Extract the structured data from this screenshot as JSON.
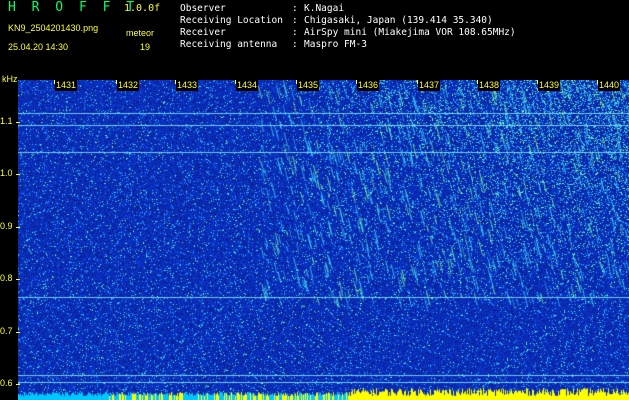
{
  "header": {
    "brand": "H R O F F T",
    "version": "1.0.0f",
    "filename": "KN9_2504201430.png",
    "meteor_label": "meteor",
    "timestamp": "25.04.20 14:30",
    "meteor_count": "19"
  },
  "info": [
    {
      "key": "Observer",
      "sep": ":",
      "value": "K.Nagai"
    },
    {
      "key": "Receiving Location",
      "sep": ":",
      "value": "Chigasaki, Japan (139.414 35.340)"
    },
    {
      "key": "Receiver",
      "sep": ":",
      "value": "AirSpy mini (Miakejima VOR 108.65MHz)"
    },
    {
      "key": "Receiving antenna",
      "sep": ":",
      "value": "Maspro FM-3"
    }
  ],
  "spectrogram": {
    "y_unit": "kHz",
    "y_ticks": [
      "1.1",
      "1.0",
      "0.9",
      "0.8",
      "0.7",
      "0.6"
    ],
    "y_range_khz": [
      0.57,
      1.18
    ],
    "x_ticks": [
      "1431",
      "1432",
      "1433",
      "1434",
      "1435",
      "1436",
      "1437",
      "1438",
      "1439",
      "1440"
    ],
    "colors": {
      "background": "#000000",
      "noise": "#1a2fd6",
      "signal": "#3de0ff",
      "strong_signal": "#7dff9a",
      "carrier": "#8fffff",
      "bottom_band_blue": "#00c8ff",
      "bottom_band_yellow": "#ffff00",
      "label": "#ffff33"
    }
  }
}
